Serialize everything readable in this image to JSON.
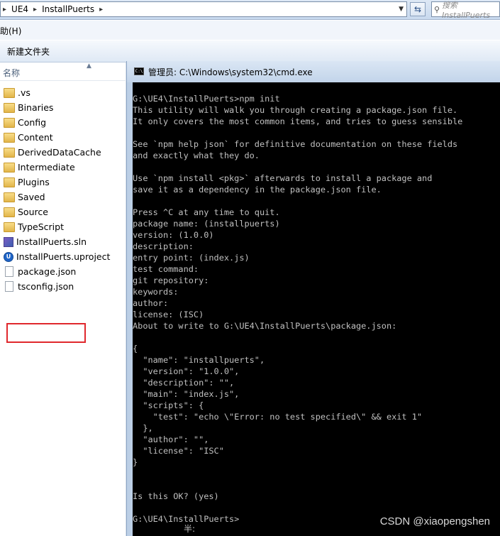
{
  "address_bar": {
    "breadcrumbs": [
      "UE4",
      "InstallPuerts"
    ],
    "search_placeholder": "搜索 InstallPuerts"
  },
  "menu": {
    "visible_item": "助(H)"
  },
  "toolbar": {
    "new_folder": "新建文件夹"
  },
  "file_list": {
    "column_header": "名称",
    "items": [
      {
        "name": ".vs",
        "type": "folder"
      },
      {
        "name": "Binaries",
        "type": "folder"
      },
      {
        "name": "Config",
        "type": "folder"
      },
      {
        "name": "Content",
        "type": "folder"
      },
      {
        "name": "DerivedDataCache",
        "type": "folder"
      },
      {
        "name": "Intermediate",
        "type": "folder"
      },
      {
        "name": "Plugins",
        "type": "folder"
      },
      {
        "name": "Saved",
        "type": "folder"
      },
      {
        "name": "Source",
        "type": "folder"
      },
      {
        "name": "TypeScript",
        "type": "folder"
      },
      {
        "name": "InstallPuerts.sln",
        "type": "sln"
      },
      {
        "name": "InstallPuerts.uproject",
        "type": "uproject"
      },
      {
        "name": "package.json",
        "type": "json",
        "highlighted": true
      },
      {
        "name": "tsconfig.json",
        "type": "json"
      }
    ],
    "highlight_color": "#e0282d"
  },
  "cmd": {
    "title": "管理员: C:\\Windows\\system32\\cmd.exe",
    "icon_text": "C:\\",
    "lines": [
      "G:\\UE4\\InstallPuerts>npm init",
      "This utility will walk you through creating a package.json file.",
      "It only covers the most common items, and tries to guess sensible",
      "",
      "See `npm help json` for definitive documentation on these fields",
      "and exactly what they do.",
      "",
      "Use `npm install <pkg>` afterwards to install a package and",
      "save it as a dependency in the package.json file.",
      "",
      "Press ^C at any time to quit.",
      "package name: (installpuerts)",
      "version: (1.0.0)",
      "description:",
      "entry point: (index.js)",
      "test command:",
      "git repository:",
      "keywords:",
      "author:",
      "license: (ISC)",
      "About to write to G:\\UE4\\InstallPuerts\\package.json:",
      "",
      "{",
      "  \"name\": \"installpuerts\",",
      "  \"version\": \"1.0.0\",",
      "  \"description\": \"\",",
      "  \"main\": \"index.js\",",
      "  \"scripts\": {",
      "    \"test\": \"echo \\\"Error: no test specified\\\" && exit 1\"",
      "  },",
      "  \"author\": \"\",",
      "  \"license\": \"ISC\"",
      "}",
      "",
      "",
      "Is this OK? (yes)",
      "",
      "G:\\UE4\\InstallPuerts>"
    ],
    "ime_indicator": "半:",
    "background": "#000000",
    "text_color": "#c0c0c0"
  },
  "watermark": "CSDN @xiaopengshen"
}
